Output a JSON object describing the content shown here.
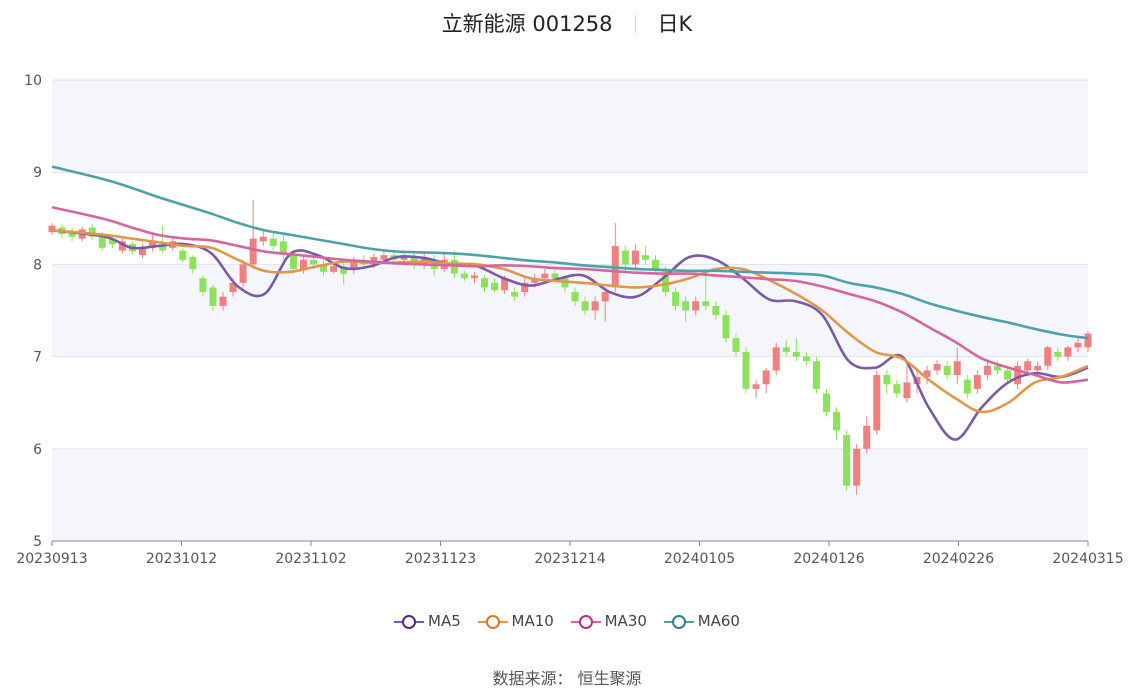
{
  "chart_data": {
    "type": "candlestick",
    "title": "立新能源 001258",
    "period_label": "日K",
    "ylim": [
      5,
      10
    ],
    "y_ticks": [
      "5",
      "6",
      "7",
      "8",
      "9",
      "10"
    ],
    "x_tick_labels": [
      "20230913",
      "20231012",
      "20231102",
      "20231123",
      "20231214",
      "20240105",
      "20240126",
      "20240226",
      "20240315"
    ],
    "grid": true,
    "legend_placement": "bottom",
    "colors": {
      "up": "#f08080",
      "down": "#8ce25a",
      "grid_band": "#f4f6fb",
      "grid_line": "#dfe3ee"
    },
    "series": [
      {
        "name": "MA5",
        "color": "#7a5aa6",
        "x": [
          0,
          8,
          12,
          16,
          20,
          24,
          28,
          32,
          36,
          40,
          44,
          48,
          52,
          56,
          60,
          64,
          68,
          72,
          76,
          80,
          84,
          88,
          92,
          96,
          100,
          104,
          108,
          112,
          116,
          120,
          124,
          128,
          132,
          136,
          140,
          144,
          148,
          152,
          156
        ],
        "y": [
          8.37,
          8.3,
          8.18,
          8.2,
          8.22,
          8.12,
          7.76,
          7.68,
          8.12,
          8.1,
          7.96,
          7.98,
          8.08,
          8.07,
          8.0,
          7.98,
          7.85,
          7.77,
          7.84,
          7.88,
          7.7,
          7.65,
          7.85,
          8.08,
          8.05,
          7.85,
          7.62,
          7.6,
          7.45,
          6.95,
          6.88,
          7.0,
          6.45,
          6.1,
          6.45,
          6.72,
          6.82,
          6.78,
          6.88
        ]
      },
      {
        "name": "MA10",
        "color": "#e0974a",
        "x": [
          0,
          8,
          12,
          16,
          20,
          24,
          28,
          32,
          36,
          40,
          44,
          48,
          52,
          56,
          60,
          64,
          68,
          72,
          76,
          80,
          84,
          88,
          92,
          96,
          100,
          104,
          108,
          112,
          116,
          120,
          124,
          128,
          132,
          136,
          140,
          144,
          148,
          152,
          156
        ],
        "y": [
          8.37,
          8.32,
          8.28,
          8.24,
          8.2,
          8.18,
          8.05,
          7.93,
          7.92,
          7.98,
          8.03,
          8.02,
          8.02,
          8.03,
          8.01,
          8.0,
          7.95,
          7.85,
          7.82,
          7.8,
          7.77,
          7.75,
          7.78,
          7.85,
          7.95,
          7.95,
          7.83,
          7.68,
          7.5,
          7.25,
          7.05,
          6.98,
          6.75,
          6.55,
          6.4,
          6.5,
          6.72,
          6.78,
          6.9
        ]
      },
      {
        "name": "MA30",
        "color": "#d6649f",
        "x": [
          0,
          8,
          12,
          16,
          20,
          24,
          28,
          32,
          36,
          40,
          44,
          48,
          52,
          56,
          60,
          64,
          68,
          72,
          76,
          80,
          84,
          88,
          92,
          96,
          100,
          104,
          108,
          112,
          116,
          120,
          124,
          128,
          132,
          136,
          140,
          144,
          148,
          152,
          156
        ],
        "y": [
          8.62,
          8.49,
          8.4,
          8.32,
          8.28,
          8.26,
          8.2,
          8.14,
          8.11,
          8.08,
          8.05,
          8.03,
          8.01,
          8.0,
          7.99,
          7.98,
          7.99,
          7.98,
          7.96,
          7.95,
          7.93,
          7.91,
          7.9,
          7.9,
          7.88,
          7.86,
          7.84,
          7.82,
          7.76,
          7.68,
          7.6,
          7.48,
          7.32,
          7.16,
          6.98,
          6.88,
          6.8,
          6.72,
          6.75
        ]
      },
      {
        "name": "MA60",
        "color": "#4ca2a8",
        "x": [
          0,
          8,
          12,
          16,
          20,
          24,
          28,
          32,
          36,
          40,
          44,
          48,
          52,
          56,
          60,
          64,
          68,
          72,
          76,
          80,
          84,
          88,
          92,
          96,
          100,
          104,
          108,
          112,
          116,
          120,
          124,
          128,
          132,
          136,
          140,
          144,
          148,
          152,
          156
        ],
        "y": [
          9.06,
          8.92,
          8.83,
          8.73,
          8.64,
          8.55,
          8.45,
          8.37,
          8.32,
          8.27,
          8.22,
          8.17,
          8.14,
          8.13,
          8.12,
          8.1,
          8.07,
          8.04,
          8.02,
          7.99,
          7.97,
          7.95,
          7.94,
          7.93,
          7.93,
          7.92,
          7.91,
          7.9,
          7.88,
          7.8,
          7.75,
          7.68,
          7.58,
          7.5,
          7.43,
          7.37,
          7.3,
          7.24,
          7.2
        ]
      }
    ],
    "candles": [
      {
        "i": 0,
        "o": 8.35,
        "c": 8.42,
        "h": 8.45,
        "l": 8.32
      },
      {
        "i": 2,
        "o": 8.4,
        "c": 8.33,
        "h": 8.43,
        "l": 8.28
      },
      {
        "i": 4,
        "o": 8.36,
        "c": 8.3,
        "h": 8.4,
        "l": 8.25
      },
      {
        "i": 6,
        "o": 8.28,
        "c": 8.38,
        "h": 8.41,
        "l": 8.25
      },
      {
        "i": 8,
        "o": 8.4,
        "c": 8.3,
        "h": 8.44,
        "l": 8.26
      },
      {
        "i": 10,
        "o": 8.32,
        "c": 8.18,
        "h": 8.35,
        "l": 8.15
      },
      {
        "i": 12,
        "o": 8.28,
        "c": 8.22,
        "h": 8.31,
        "l": 8.18
      },
      {
        "i": 14,
        "o": 8.15,
        "c": 8.25,
        "h": 8.28,
        "l": 8.12
      },
      {
        "i": 16,
        "o": 8.22,
        "c": 8.14,
        "h": 8.25,
        "l": 8.11
      },
      {
        "i": 18,
        "o": 8.1,
        "c": 8.18,
        "h": 8.22,
        "l": 8.07
      },
      {
        "i": 20,
        "o": 8.18,
        "c": 8.25,
        "h": 8.33,
        "l": 8.14
      },
      {
        "i": 22,
        "o": 8.2,
        "c": 8.15,
        "h": 8.42,
        "l": 8.12
      },
      {
        "i": 24,
        "o": 8.18,
        "c": 8.25,
        "h": 8.28,
        "l": 8.15
      },
      {
        "i": 26,
        "o": 8.15,
        "c": 8.05,
        "h": 8.18,
        "l": 8.02
      },
      {
        "i": 28,
        "o": 8.08,
        "c": 7.95,
        "h": 8.1,
        "l": 7.9
      },
      {
        "i": 30,
        "o": 7.85,
        "c": 7.7,
        "h": 7.88,
        "l": 7.65
      },
      {
        "i": 32,
        "o": 7.75,
        "c": 7.55,
        "h": 7.78,
        "l": 7.5
      },
      {
        "i": 34,
        "o": 7.55,
        "c": 7.65,
        "h": 7.7,
        "l": 7.5
      },
      {
        "i": 36,
        "o": 7.7,
        "c": 7.8,
        "h": 7.85,
        "l": 7.65
      },
      {
        "i": 38,
        "o": 7.8,
        "c": 8.0,
        "h": 8.05,
        "l": 7.75
      },
      {
        "i": 40,
        "o": 8.0,
        "c": 8.28,
        "h": 8.7,
        "l": 7.95
      },
      {
        "i": 42,
        "o": 8.25,
        "c": 8.3,
        "h": 8.38,
        "l": 8.2
      },
      {
        "i": 44,
        "o": 8.28,
        "c": 8.2,
        "h": 8.35,
        "l": 8.15
      },
      {
        "i": 46,
        "o": 8.25,
        "c": 8.1,
        "h": 8.32,
        "l": 8.05
      },
      {
        "i": 48,
        "o": 8.1,
        "c": 7.95,
        "h": 8.12,
        "l": 7.9
      },
      {
        "i": 50,
        "o": 7.95,
        "c": 8.05,
        "h": 8.1,
        "l": 7.9
      },
      {
        "i": 52,
        "o": 8.05,
        "c": 8.0,
        "h": 8.1,
        "l": 7.95
      },
      {
        "i": 54,
        "o": 8.0,
        "c": 7.92,
        "h": 8.05,
        "l": 7.88
      },
      {
        "i": 56,
        "o": 7.92,
        "c": 7.98,
        "h": 8.02,
        "l": 7.9
      },
      {
        "i": 58,
        "o": 7.98,
        "c": 7.9,
        "h": 8.03,
        "l": 7.78
      },
      {
        "i": 60,
        "o": 7.95,
        "c": 8.05,
        "h": 8.08,
        "l": 7.9
      },
      {
        "i": 62,
        "o": 8.05,
        "c": 8.0,
        "h": 8.1,
        "l": 7.96
      },
      {
        "i": 64,
        "o": 8.0,
        "c": 8.08,
        "h": 8.12,
        "l": 7.96
      },
      {
        "i": 66,
        "o": 8.05,
        "c": 8.1,
        "h": 8.14,
        "l": 8.0
      },
      {
        "i": 68,
        "o": 8.1,
        "c": 8.05,
        "h": 8.15,
        "l": 8.0
      },
      {
        "i": 70,
        "o": 8.05,
        "c": 8.1,
        "h": 8.13,
        "l": 8.0
      },
      {
        "i": 72,
        "o": 8.08,
        "c": 8.0,
        "h": 8.12,
        "l": 7.95
      },
      {
        "i": 74,
        "o": 8.0,
        "c": 8.08,
        "h": 8.12,
        "l": 7.95
      },
      {
        "i": 76,
        "o": 8.05,
        "c": 7.95,
        "h": 8.1,
        "l": 7.88
      },
      {
        "i": 78,
        "o": 7.95,
        "c": 8.05,
        "h": 8.12,
        "l": 7.92
      },
      {
        "i": 80,
        "o": 8.05,
        "c": 7.9,
        "h": 8.15,
        "l": 7.85
      },
      {
        "i": 82,
        "o": 7.9,
        "c": 7.85,
        "h": 7.93,
        "l": 7.82
      },
      {
        "i": 84,
        "o": 7.85,
        "c": 7.88,
        "h": 7.92,
        "l": 7.8
      },
      {
        "i": 86,
        "o": 7.85,
        "c": 7.75,
        "h": 7.88,
        "l": 7.7
      },
      {
        "i": 88,
        "o": 7.8,
        "c": 7.72,
        "h": 7.85,
        "l": 7.7
      },
      {
        "i": 90,
        "o": 7.72,
        "c": 7.85,
        "h": 7.88,
        "l": 7.68
      },
      {
        "i": 92,
        "o": 7.7,
        "c": 7.65,
        "h": 7.75,
        "l": 7.6
      },
      {
        "i": 94,
        "o": 7.7,
        "c": 7.8,
        "h": 7.85,
        "l": 7.65
      },
      {
        "i": 96,
        "o": 7.8,
        "c": 7.85,
        "h": 7.9,
        "l": 7.75
      },
      {
        "i": 98,
        "o": 7.85,
        "c": 7.9,
        "h": 7.95,
        "l": 7.8
      },
      {
        "i": 100,
        "o": 7.9,
        "c": 7.85,
        "h": 7.95,
        "l": 7.8
      },
      {
        "i": 102,
        "o": 7.85,
        "c": 7.75,
        "h": 7.88,
        "l": 7.7
      },
      {
        "i": 104,
        "o": 7.7,
        "c": 7.6,
        "h": 7.75,
        "l": 7.55
      },
      {
        "i": 106,
        "o": 7.6,
        "c": 7.5,
        "h": 7.65,
        "l": 7.45
      },
      {
        "i": 108,
        "o": 7.5,
        "c": 7.6,
        "h": 7.65,
        "l": 7.4
      },
      {
        "i": 110,
        "o": 7.6,
        "c": 7.7,
        "h": 7.75,
        "l": 7.38
      },
      {
        "i": 112,
        "o": 7.75,
        "c": 8.2,
        "h": 8.45,
        "l": 7.7
      },
      {
        "i": 114,
        "o": 8.15,
        "c": 8.0,
        "h": 8.2,
        "l": 7.9
      },
      {
        "i": 116,
        "o": 8.0,
        "c": 8.15,
        "h": 8.22,
        "l": 7.95
      },
      {
        "i": 118,
        "o": 8.1,
        "c": 8.05,
        "h": 8.2,
        "l": 8.0
      },
      {
        "i": 120,
        "o": 8.05,
        "c": 7.95,
        "h": 8.1,
        "l": 7.9
      },
      {
        "i": 122,
        "o": 7.95,
        "c": 7.7,
        "h": 7.98,
        "l": 7.65
      },
      {
        "i": 124,
        "o": 7.7,
        "c": 7.55,
        "h": 7.75,
        "l": 7.5
      },
      {
        "i": 126,
        "o": 7.6,
        "c": 7.5,
        "h": 7.65,
        "l": 7.38
      },
      {
        "i": 128,
        "o": 7.5,
        "c": 7.6,
        "h": 7.65,
        "l": 7.45
      },
      {
        "i": 130,
        "o": 7.6,
        "c": 7.55,
        "h": 7.9,
        "l": 7.5
      },
      {
        "i": 132,
        "o": 7.55,
        "c": 7.45,
        "h": 7.6,
        "l": 7.4
      },
      {
        "i": 134,
        "o": 7.45,
        "c": 7.2,
        "h": 7.5,
        "l": 7.15
      },
      {
        "i": 136,
        "o": 7.2,
        "c": 7.05,
        "h": 7.25,
        "l": 7.0
      },
      {
        "i": 138,
        "o": 7.05,
        "c": 6.65,
        "h": 7.1,
        "l": 6.6
      },
      {
        "i": 140,
        "o": 6.65,
        "c": 6.7,
        "h": 6.75,
        "l": 6.55
      },
      {
        "i": 142,
        "o": 6.7,
        "c": 6.85,
        "h": 6.88,
        "l": 6.6
      },
      {
        "i": 144,
        "o": 6.85,
        "c": 7.1,
        "h": 7.15,
        "l": 6.8
      },
      {
        "i": 146,
        "o": 7.1,
        "c": 7.05,
        "h": 7.18,
        "l": 7.0
      },
      {
        "i": 148,
        "o": 7.05,
        "c": 7.0,
        "h": 7.2,
        "l": 6.95
      },
      {
        "i": 150,
        "o": 7.0,
        "c": 6.95,
        "h": 7.05,
        "l": 6.9
      },
      {
        "i": 152,
        "o": 6.95,
        "c": 6.65,
        "h": 7.0,
        "l": 6.6
      },
      {
        "i": 154,
        "o": 6.6,
        "c": 6.4,
        "h": 6.65,
        "l": 6.35
      },
      {
        "i": 156,
        "o": 6.4,
        "c": 6.2,
        "h": 6.45,
        "l": 6.1
      },
      {
        "i": 158,
        "o": 6.15,
        "c": 5.6,
        "h": 6.2,
        "l": 5.55
      },
      {
        "i": 160,
        "o": 5.6,
        "c": 6.0,
        "h": 6.05,
        "l": 5.5
      },
      {
        "i": 162,
        "o": 6.0,
        "c": 6.25,
        "h": 6.35,
        "l": 5.95
      },
      {
        "i": 164,
        "o": 6.2,
        "c": 6.8,
        "h": 6.85,
        "l": 6.15
      },
      {
        "i": 166,
        "o": 6.8,
        "c": 6.7,
        "h": 6.85,
        "l": 6.6
      },
      {
        "i": 168,
        "o": 6.7,
        "c": 6.6,
        "h": 6.75,
        "l": 6.55
      },
      {
        "i": 170,
        "o": 6.55,
        "c": 6.72,
        "h": 6.9,
        "l": 6.5
      },
      {
        "i": 172,
        "o": 6.7,
        "c": 6.78,
        "h": 6.85,
        "l": 6.6
      },
      {
        "i": 174,
        "o": 6.78,
        "c": 6.85,
        "h": 6.9,
        "l": 6.7
      },
      {
        "i": 176,
        "o": 6.85,
        "c": 6.92,
        "h": 6.96,
        "l": 6.8
      },
      {
        "i": 178,
        "o": 6.9,
        "c": 6.8,
        "h": 6.95,
        "l": 6.75
      },
      {
        "i": 180,
        "o": 6.8,
        "c": 6.95,
        "h": 7.1,
        "l": 6.7
      },
      {
        "i": 182,
        "o": 6.75,
        "c": 6.6,
        "h": 6.8,
        "l": 6.55
      },
      {
        "i": 184,
        "o": 6.65,
        "c": 6.8,
        "h": 6.85,
        "l": 6.6
      },
      {
        "i": 186,
        "o": 6.8,
        "c": 6.9,
        "h": 6.95,
        "l": 6.75
      },
      {
        "i": 188,
        "o": 6.9,
        "c": 6.85,
        "h": 6.95,
        "l": 6.8
      },
      {
        "i": 190,
        "o": 6.85,
        "c": 6.75,
        "h": 6.9,
        "l": 6.7
      },
      {
        "i": 192,
        "o": 6.7,
        "c": 6.9,
        "h": 6.95,
        "l": 6.65
      },
      {
        "i": 194,
        "o": 6.85,
        "c": 6.95,
        "h": 6.98,
        "l": 6.8
      },
      {
        "i": 196,
        "o": 6.85,
        "c": 6.9,
        "h": 6.95,
        "l": 6.8
      },
      {
        "i": 198,
        "o": 6.9,
        "c": 7.1,
        "h": 7.12,
        "l": 6.85
      },
      {
        "i": 200,
        "o": 7.05,
        "c": 7.0,
        "h": 7.1,
        "l": 6.95
      },
      {
        "i": 202,
        "o": 7.0,
        "c": 7.1,
        "h": 7.12,
        "l": 6.95
      },
      {
        "i": 204,
        "o": 7.1,
        "c": 7.15,
        "h": 7.2,
        "l": 7.05
      },
      {
        "i": 206,
        "o": 7.1,
        "c": 7.25,
        "h": 7.28,
        "l": 7.05
      }
    ],
    "x_count": 207
  },
  "legend": {
    "items": [
      "MA5",
      "MA10",
      "MA30",
      "MA60"
    ]
  },
  "source_text": "数据来源：  恒生聚源"
}
